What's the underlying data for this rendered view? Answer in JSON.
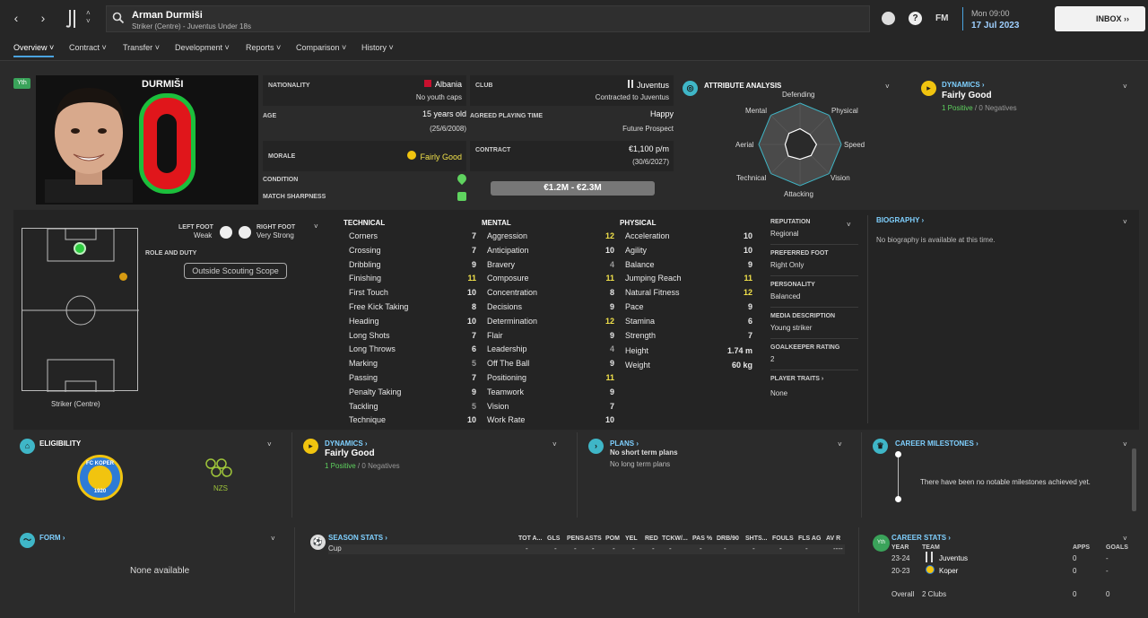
{
  "header": {
    "player_name": "Arman Durmiši",
    "player_sub": "Striker (Centre) - Juventus Under 18s",
    "game_label": "FM",
    "date_line1": "Mon 09:00",
    "date_line2": "17 Jul 2023",
    "inbox_label": "INBOX"
  },
  "tabs": [
    "Overview",
    "Contract",
    "Transfer",
    "Development",
    "Reports",
    "Comparison",
    "History"
  ],
  "profile": {
    "youth_badge": "Yth",
    "shirt_name": "DURMIŠI",
    "shirt_number": "0",
    "nationality_label": "NATIONALITY",
    "nationality": "Albania",
    "youth_caps": "No youth caps",
    "club_label": "CLUB",
    "club": "Juventus",
    "club_status": "Contracted to Juventus",
    "age_label": "AGE",
    "age": "15 years old",
    "dob": "(25/6/2008)",
    "agreed_role_label": "AGREED PLAYING TIME",
    "agreed_role": "Happy",
    "future_role": "Future Prospect",
    "morale_label": "MORALE",
    "morale": "Fairly Good",
    "contract_label": "CONTRACT",
    "wage": "€1,100 p/m",
    "expiry": "(30/6/2027)",
    "condition_label": "CONDITION",
    "sharpness_label": "MATCH SHARPNESS",
    "value": "€1.2M - €2.3M"
  },
  "attribute_analysis": {
    "title": "ATTRIBUTE ANALYSIS",
    "axes": [
      "Defending",
      "Physical",
      "Speed",
      "Vision",
      "Attacking",
      "Technical",
      "Aerial",
      "Mental"
    ],
    "levels": [
      0.38,
      0.34,
      0.4,
      0.38,
      0.36,
      0.4,
      0.36,
      0.38
    ]
  },
  "dynamics_top": {
    "title": "DYNAMICS",
    "value": "Fairly Good",
    "positives": "1 Positive",
    "negatives": "0 Negatives"
  },
  "pitch": {
    "left_foot_label": "LEFT FOOT",
    "left_foot": "Weak",
    "right_foot_label": "RIGHT FOOT",
    "right_foot": "Very Strong",
    "role_label": "ROLE AND DUTY",
    "scouting": "Outside Scouting Scope",
    "position": "Striker (Centre)"
  },
  "technical": {
    "title": "TECHNICAL",
    "items": [
      {
        "name": "Corners",
        "value": "7"
      },
      {
        "name": "Crossing",
        "value": "7"
      },
      {
        "name": "Dribbling",
        "value": "9"
      },
      {
        "name": "Finishing",
        "value": "11"
      },
      {
        "name": "First Touch",
        "value": "10"
      },
      {
        "name": "Free Kick Taking",
        "value": "8"
      },
      {
        "name": "Heading",
        "value": "10"
      },
      {
        "name": "Long Shots",
        "value": "7"
      },
      {
        "name": "Long Throws",
        "value": "6"
      },
      {
        "name": "Marking",
        "value": "5"
      },
      {
        "name": "Passing",
        "value": "7"
      },
      {
        "name": "Penalty Taking",
        "value": "9"
      },
      {
        "name": "Tackling",
        "value": "5"
      },
      {
        "name": "Technique",
        "value": "10"
      }
    ]
  },
  "mental": {
    "title": "MENTAL",
    "items": [
      {
        "name": "Aggression",
        "value": "12"
      },
      {
        "name": "Anticipation",
        "value": "10"
      },
      {
        "name": "Bravery",
        "value": "4"
      },
      {
        "name": "Composure",
        "value": "11"
      },
      {
        "name": "Concentration",
        "value": "8"
      },
      {
        "name": "Decisions",
        "value": "9"
      },
      {
        "name": "Determination",
        "value": "12"
      },
      {
        "name": "Flair",
        "value": "9"
      },
      {
        "name": "Leadership",
        "value": "4"
      },
      {
        "name": "Off The Ball",
        "value": "9"
      },
      {
        "name": "Positioning",
        "value": "11"
      },
      {
        "name": "Teamwork",
        "value": "9"
      },
      {
        "name": "Vision",
        "value": "7"
      },
      {
        "name": "Work Rate",
        "value": "10"
      }
    ]
  },
  "physical": {
    "title": "PHYSICAL",
    "items": [
      {
        "name": "Acceleration",
        "value": "10"
      },
      {
        "name": "Agility",
        "value": "10"
      },
      {
        "name": "Balance",
        "value": "9"
      },
      {
        "name": "Jumping Reach",
        "value": "11"
      },
      {
        "name": "Natural Fitness",
        "value": "12"
      },
      {
        "name": "Pace",
        "value": "9"
      },
      {
        "name": "Stamina",
        "value": "6"
      },
      {
        "name": "Strength",
        "value": "7"
      }
    ],
    "height_label": "Height",
    "height": "1.74 m",
    "weight_label": "Weight",
    "weight": "60 kg"
  },
  "side_info": {
    "reputation_label": "REPUTATION",
    "reputation": "Regional",
    "pref_foot_label": "PREFERRED FOOT",
    "pref_foot": "Right Only",
    "personality_label": "PERSONALITY",
    "personality": "Balanced",
    "media_label": "MEDIA DESCRIPTION",
    "media": "Young striker",
    "gk_label": "GOALKEEPER RATING",
    "gk": "2",
    "traits_label": "PLAYER TRAITS",
    "traits": "None"
  },
  "biography": {
    "title": "BIOGRAPHY",
    "text": "No biography is available at this time."
  },
  "eligibility": {
    "title": "ELIGIBILITY",
    "logo1_text": "FC KOPER",
    "logo1_year": "1920",
    "logo2_text": "NZS"
  },
  "dynamics_mid": {
    "title": "DYNAMICS",
    "value": "Fairly Good",
    "positives": "1 Positive",
    "negatives": "0 Negatives"
  },
  "plans": {
    "title": "PLANS",
    "short": "No short term plans",
    "long": "No long term plans"
  },
  "milestones": {
    "title": "CAREER MILESTONES",
    "text": "There have been no notable milestones achieved yet."
  },
  "form": {
    "title": "FORM",
    "text": "None available"
  },
  "season_stats": {
    "title": "SEASON STATS",
    "headers": [
      "TOT A...",
      "GLS",
      "PENS",
      "ASTS",
      "POM",
      "YEL",
      "RED",
      "TCKW/...",
      "PAS %",
      "DRB/90",
      "SHTS...",
      "FOULS",
      "FLS AG",
      "AV R"
    ],
    "row_label": "Cup",
    "row_values": [
      "-",
      "-",
      "-",
      "-",
      "-",
      "-",
      "-",
      "-",
      "-",
      "-",
      "-",
      "-",
      "-",
      "----"
    ]
  },
  "career_stats": {
    "title": "CAREER STATS",
    "badge": "Yth",
    "col_year": "YEAR",
    "col_team": "TEAM",
    "col_apps": "APPS",
    "col_goals": "GOALS",
    "rows": [
      {
        "year": "23-24",
        "team": "Juventus",
        "apps": "0",
        "goals": "-"
      },
      {
        "year": "20-23",
        "team": "Koper",
        "apps": "0",
        "goals": "-"
      }
    ],
    "overall_label": "Overall",
    "overall_team": "2 Clubs",
    "overall_apps": "0",
    "overall_goals": "0"
  },
  "colors": {
    "accent": "#4aa3df",
    "highlight": "#f1e14a",
    "positive": "#5fd35f",
    "shirt_red": "#e0161b"
  }
}
